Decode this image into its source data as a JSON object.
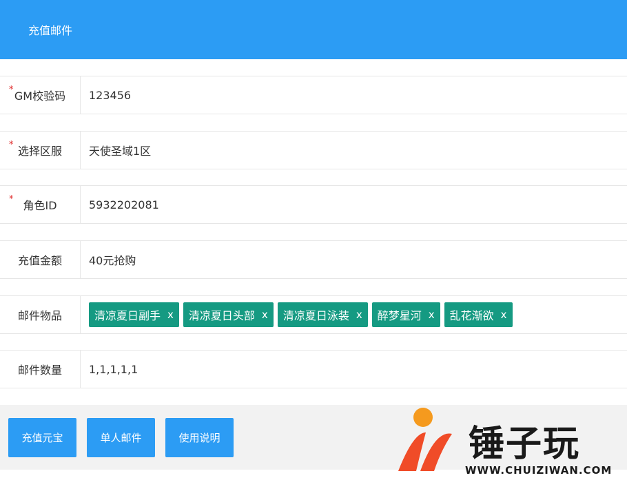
{
  "colors": {
    "primary": "#2c9cf4",
    "tag": "#159a82",
    "required": "#e02d2d"
  },
  "header": {
    "title": "充值邮件"
  },
  "form": {
    "gm_code": {
      "label": "GM校验码",
      "required": "*",
      "value": "123456"
    },
    "server": {
      "label": "选择区服",
      "required": "*",
      "value": "天使圣域1区"
    },
    "role_id": {
      "label": "角色ID",
      "required": "*",
      "value": "5932202081"
    },
    "amount": {
      "label": "充值金额",
      "value": "40元抢购"
    },
    "items": {
      "label": "邮件物品",
      "tags": [
        {
          "text": "清凉夏日副手",
          "remove": "x"
        },
        {
          "text": "清凉夏日头部",
          "remove": "x"
        },
        {
          "text": "清凉夏日泳装",
          "remove": "x"
        },
        {
          "text": "醉梦星河",
          "remove": "x"
        },
        {
          "text": "乱花渐欲",
          "remove": "x"
        }
      ]
    },
    "quantity": {
      "label": "邮件数量",
      "value": "1,1,1,1,1"
    }
  },
  "buttons": {
    "recharge": "充值元宝",
    "single_mail": "单人邮件",
    "instructions": "使用说明"
  },
  "watermark": {
    "brand": "锤子玩",
    "url": "WWW.CHUIZIWAN.COM"
  }
}
